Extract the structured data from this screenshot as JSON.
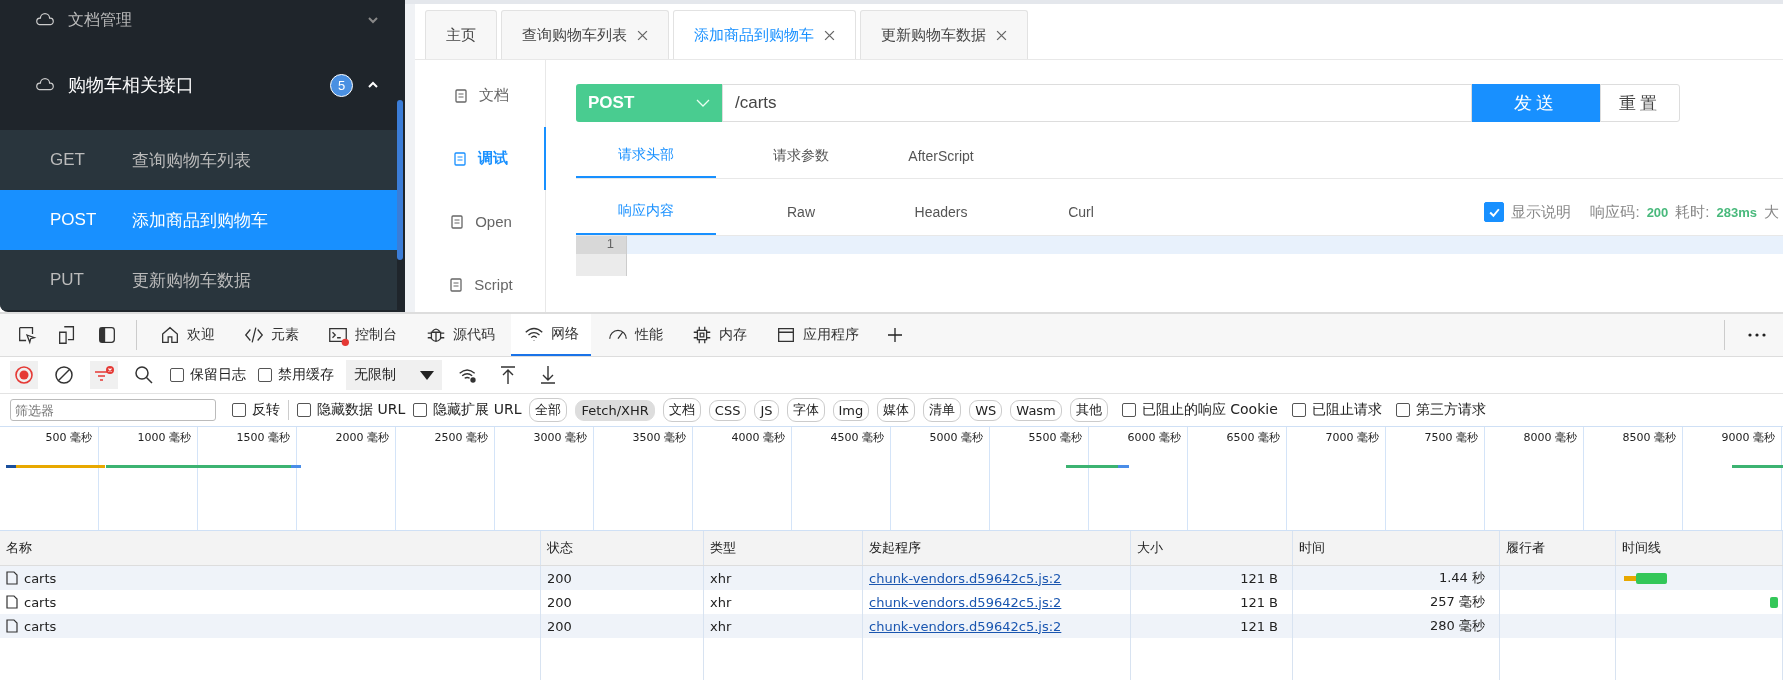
{
  "sidebar": {
    "items": [
      {
        "label": "文档管理",
        "expanded": false
      },
      {
        "label": "购物车相关接口",
        "badge": "5",
        "expanded": true,
        "children": [
          {
            "method": "GET",
            "label": "查询购物车列表",
            "selected": false
          },
          {
            "method": "POST",
            "label": "添加商品到购物车",
            "selected": true
          },
          {
            "method": "PUT",
            "label": "更新购物车数据",
            "selected": false
          }
        ]
      }
    ]
  },
  "tabs": [
    {
      "label": "主页",
      "closable": false,
      "selected": false
    },
    {
      "label": "查询购物车列表",
      "closable": true,
      "selected": false
    },
    {
      "label": "添加商品到购物车",
      "closable": true,
      "selected": true
    },
    {
      "label": "更新购物车数据",
      "closable": true,
      "selected": false
    }
  ],
  "side_nav": [
    {
      "label": "文档",
      "selected": false
    },
    {
      "label": "调试",
      "selected": true
    },
    {
      "label": "Open",
      "selected": false
    },
    {
      "label": "Script",
      "selected": false
    }
  ],
  "request": {
    "method": "POST",
    "url": "/carts",
    "send": "发送",
    "reset": "重置"
  },
  "request_tabs": [
    {
      "label": "请求头部",
      "selected": true
    },
    {
      "label": "请求参数",
      "selected": false
    },
    {
      "label": "AfterScript",
      "selected": false
    }
  ],
  "response_tabs": [
    {
      "label": "响应内容",
      "selected": true
    },
    {
      "label": "Raw",
      "selected": false
    },
    {
      "label": "Headers",
      "selected": false
    },
    {
      "label": "Curl",
      "selected": false
    }
  ],
  "response_info": {
    "show_desc": {
      "label": "显示说明",
      "checked": true
    },
    "code_label": "响应码:",
    "code": "200",
    "time_label": "耗时:",
    "time": "283ms",
    "size_label": "大"
  },
  "editor": {
    "line_numbers": [
      "1"
    ]
  },
  "devtools": {
    "tabs": [
      {
        "label": "欢迎",
        "selected": false
      },
      {
        "label": "元素",
        "selected": false
      },
      {
        "label": "控制台",
        "selected": false
      },
      {
        "label": "源代码",
        "selected": false
      },
      {
        "label": "网络",
        "selected": true
      },
      {
        "label": "性能",
        "selected": false
      },
      {
        "label": "内存",
        "selected": false
      },
      {
        "label": "应用程序",
        "selected": false
      }
    ],
    "toolbar": {
      "recording": true,
      "preserve_log": {
        "label": "保留日志",
        "checked": false
      },
      "disable_cache": {
        "label": "禁用缓存",
        "checked": false
      },
      "throttle": "无限制"
    },
    "filter": {
      "placeholder": "筛选器",
      "invert": {
        "label": "反转",
        "checked": false
      },
      "hide_data_url": {
        "label": "隐藏数据 URL",
        "checked": false
      },
      "hide_ext_url": {
        "label": "隐藏扩展 URL",
        "checked": false
      },
      "types": [
        {
          "label": "全部",
          "selected": false
        },
        {
          "label": "Fetch/XHR",
          "selected": true
        },
        {
          "label": "文档",
          "selected": false
        },
        {
          "label": "CSS",
          "selected": false
        },
        {
          "label": "JS",
          "selected": false
        },
        {
          "label": "字体",
          "selected": false
        },
        {
          "label": "Img",
          "selected": false
        },
        {
          "label": "媒体",
          "selected": false
        },
        {
          "label": "清单",
          "selected": false
        },
        {
          "label": "WS",
          "selected": false
        },
        {
          "label": "Wasm",
          "selected": false
        },
        {
          "label": "其他",
          "selected": false
        }
      ],
      "extra": [
        {
          "label": "已阻止的响应 Cookie",
          "checked": false
        },
        {
          "label": "已阻止请求",
          "checked": false
        },
        {
          "label": "第三方请求",
          "checked": false
        }
      ]
    },
    "overview": {
      "ticks": [
        "500 毫秒",
        "1000 毫秒",
        "1500 毫秒",
        "2000 毫秒",
        "2500 毫秒",
        "3000 毫秒",
        "3500 毫秒",
        "4000 毫秒",
        "4500 毫秒",
        "5000 毫秒",
        "5500 毫秒",
        "6000 毫秒",
        "6500 毫秒",
        "7000 毫秒",
        "7500 毫秒",
        "8000 毫秒",
        "8500 毫秒",
        "9000 毫秒"
      ]
    },
    "table": {
      "columns": [
        "名称",
        "状态",
        "类型",
        "发起程序",
        "大小",
        "时间",
        "履行者",
        "时间线"
      ],
      "rows": [
        {
          "name": "carts",
          "status": "200",
          "type": "xhr",
          "initiator": "chunk-vendors.d59642c5.js:2",
          "size": "121 B",
          "time": "1.44 秒"
        },
        {
          "name": "carts",
          "status": "200",
          "type": "xhr",
          "initiator": "chunk-vendors.d59642c5.js:2",
          "size": "121 B",
          "time": "257 毫秒"
        },
        {
          "name": "carts",
          "status": "200",
          "type": "xhr",
          "initiator": "chunk-vendors.d59642c5.js:2",
          "size": "121 B",
          "time": "280 毫秒"
        }
      ]
    }
  }
}
